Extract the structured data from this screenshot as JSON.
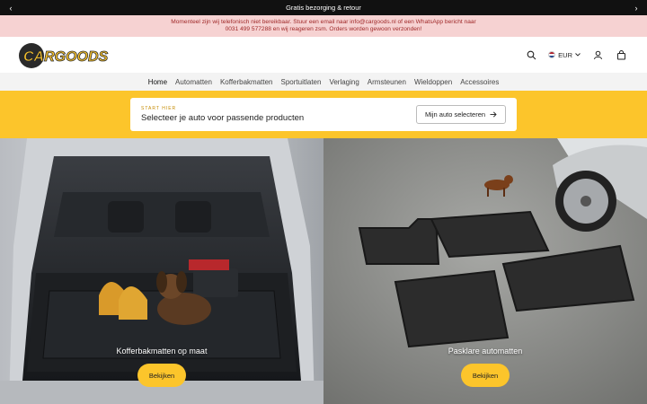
{
  "announcement": {
    "text": "Gratis bezorging & retour",
    "prev_symbol": "‹",
    "next_symbol": "›"
  },
  "notice": {
    "text": "Momenteel zijn wij telefonisch niet bereikbaar. Stuur een email naar info@cargoods.nl of een WhatsApp bericht naar 0031 499 577288 en wij reageren zsm. Orders worden gewoon verzonden!"
  },
  "header": {
    "logo_text": "CARGOODS",
    "currency": "EUR",
    "icons": [
      "search-icon",
      "flag-nl-icon",
      "chevron-down-icon",
      "account-icon",
      "cart-icon"
    ]
  },
  "nav": {
    "items": [
      "Home",
      "Automatten",
      "Kofferbakmatten",
      "Sportuitlaten",
      "Verlaging",
      "Armsteunen",
      "Wieldoppen",
      "Accessoires"
    ],
    "active": "Home"
  },
  "selector": {
    "eyebrow": "START HIER",
    "label": "Selecteer je auto voor passende producten",
    "button": "Mijn auto selecteren",
    "button_icon": "arrow-right-icon"
  },
  "cards": [
    {
      "caption": "Kofferbakmatten op maat",
      "button": "Bekijken"
    },
    {
      "caption": "Pasklare automatten",
      "button": "Bekijken"
    }
  ],
  "colors": {
    "accent": "#fcc52b",
    "notice_bg": "#f6d2d2",
    "notice_text": "#a02a2a",
    "topbar": "#111111"
  }
}
